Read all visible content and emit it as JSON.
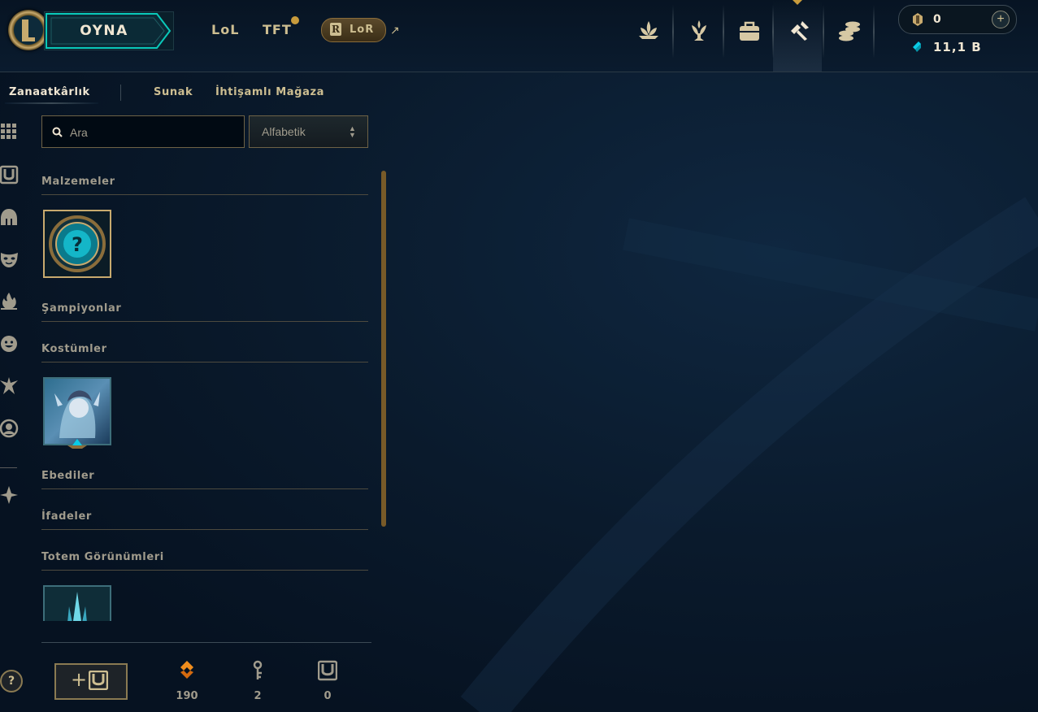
{
  "header": {
    "play_label": "OYNA",
    "game_tabs": [
      "LoL",
      "TFT"
    ],
    "lor_label": "LoR",
    "nav_icons": [
      "lotus-icon",
      "trophy-icon",
      "bag-icon",
      "hextech-crafting-icon",
      "coins-stack-icon"
    ],
    "active_nav": "hextech-crafting-icon",
    "rp_value": "0",
    "be_value": "11,1 B"
  },
  "subnav": {
    "tabs": [
      "Zanaatkârlık",
      "Sunak",
      "İhtişamlı Mağaza"
    ],
    "active": 0
  },
  "rail": {
    "icons": [
      "grid-icon",
      "chest-icon",
      "helmet-icon",
      "mask-icon",
      "flame-icon",
      "emote-icon",
      "ward-icon",
      "profile-icon",
      "event-icon"
    ]
  },
  "search": {
    "placeholder": "Ara"
  },
  "sort": {
    "value": "Alfabetik"
  },
  "sections": [
    {
      "title": "Malzemeler"
    },
    {
      "title": "Şampiyonlar"
    },
    {
      "title": "Kostümler"
    },
    {
      "title": "Ebediler"
    },
    {
      "title": "İfadeler"
    },
    {
      "title": "Totem Görünümleri"
    }
  ],
  "footer": {
    "orange_essence": "190",
    "keys": "2",
    "chests": "0"
  },
  "help_label": "?"
}
